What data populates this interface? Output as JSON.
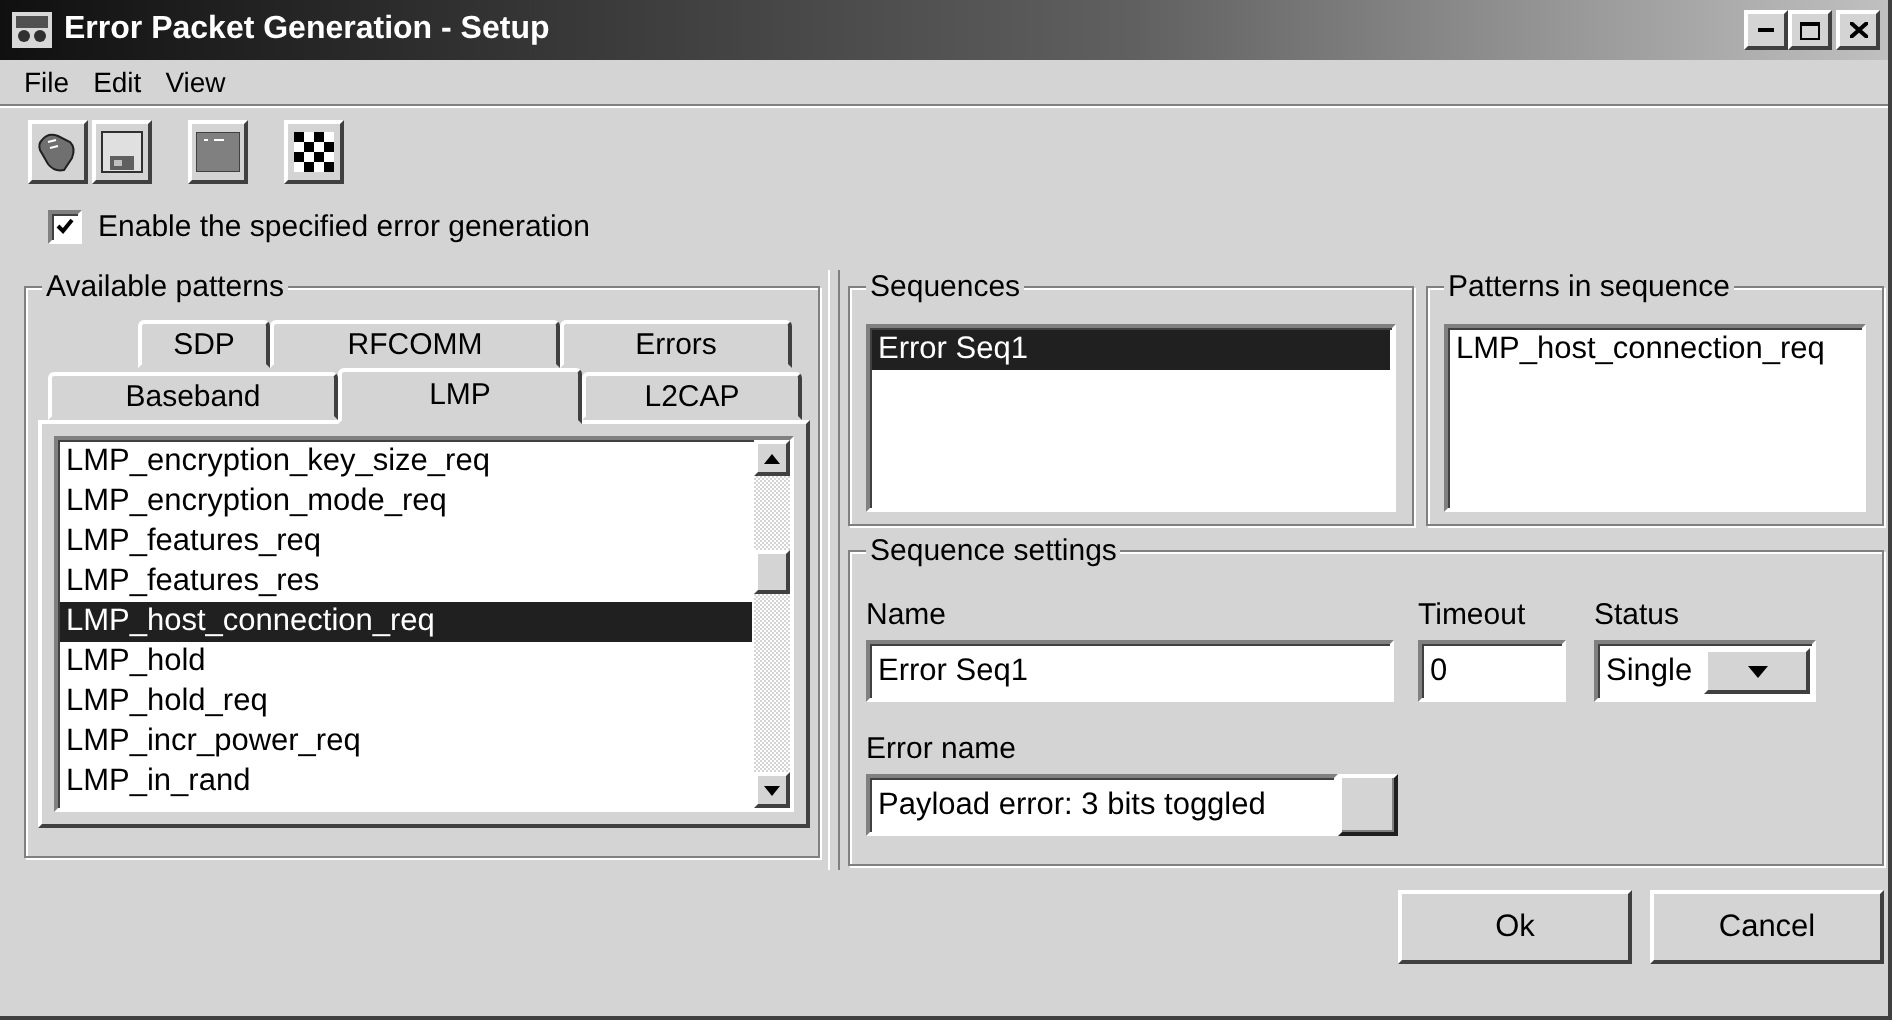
{
  "window": {
    "title": "Error Packet Generation - Setup"
  },
  "menu": [
    "File",
    "Edit",
    "View"
  ],
  "enable_checkbox": {
    "label": "Enable the specified error generation",
    "checked": true
  },
  "available_patterns": {
    "title": "Available patterns",
    "tab_rows": [
      [
        {
          "label": "SDP",
          "selected": false
        },
        {
          "label": "RFCOMM",
          "selected": false
        },
        {
          "label": "Errors",
          "selected": false
        }
      ],
      [
        {
          "label": "Baseband",
          "selected": false
        },
        {
          "label": "LMP",
          "selected": true
        },
        {
          "label": "L2CAP",
          "selected": false
        }
      ]
    ],
    "items": [
      {
        "label": "LMP_encryption_key_size_req",
        "selected": false
      },
      {
        "label": "LMP_encryption_mode_req",
        "selected": false
      },
      {
        "label": "LMP_features_req",
        "selected": false
      },
      {
        "label": "LMP_features_res",
        "selected": false
      },
      {
        "label": "LMP_host_connection_req",
        "selected": true
      },
      {
        "label": "LMP_hold",
        "selected": false
      },
      {
        "label": "LMP_hold_req",
        "selected": false
      },
      {
        "label": "LMP_incr_power_req",
        "selected": false
      },
      {
        "label": "LMP_in_rand",
        "selected": false
      }
    ]
  },
  "sequences": {
    "title": "Sequences",
    "items": [
      {
        "label": "Error Seq1",
        "selected": true
      }
    ]
  },
  "patterns_in_sequence": {
    "title": "Patterns in sequence",
    "items": [
      {
        "label": "LMP_host_connection_req",
        "selected": false
      }
    ]
  },
  "sequence_settings": {
    "title": "Sequence settings",
    "name": {
      "label": "Name",
      "value": "Error Seq1"
    },
    "timeout": {
      "label": "Timeout",
      "value": "0"
    },
    "status": {
      "label": "Status",
      "value": "Single"
    },
    "error_name": {
      "label": "Error name",
      "value": "Payload error: 3 bits toggled"
    }
  },
  "buttons": [
    "Ok",
    "Cancel"
  ]
}
